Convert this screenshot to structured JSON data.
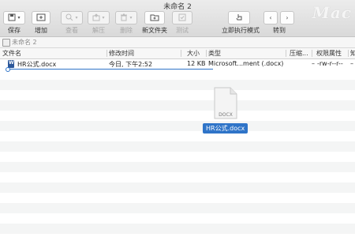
{
  "window": {
    "title": "未命名 2",
    "brand": "Mac"
  },
  "toolbar": {
    "save": "保存",
    "add": "增加",
    "view": "查看",
    "extract": "解压",
    "delete": "删除",
    "new_folder": "新文件夹",
    "test": "测试",
    "immediate_mode": "立即执行模式",
    "goto": "转到"
  },
  "path": {
    "label": "未命名 2"
  },
  "columns": {
    "name": "文件名",
    "modified": "修改时间",
    "size": "大小",
    "type": "类型",
    "compressed": "压缩...",
    "permissions": "权限属性",
    "extra": "知"
  },
  "files": [
    {
      "name": "HR公式.docx",
      "modified": "今日, 下午2:52",
      "size": "12 KB",
      "type": "Microsoft...ment (.docx)",
      "compressed": "–",
      "permissions": "-rw-r--r--",
      "extra": "–"
    }
  ],
  "drag": {
    "badge": "DOCX",
    "label": "HR公式.docx"
  },
  "colors": {
    "selection": "#2f74c8",
    "word_icon": "#2b579a"
  }
}
